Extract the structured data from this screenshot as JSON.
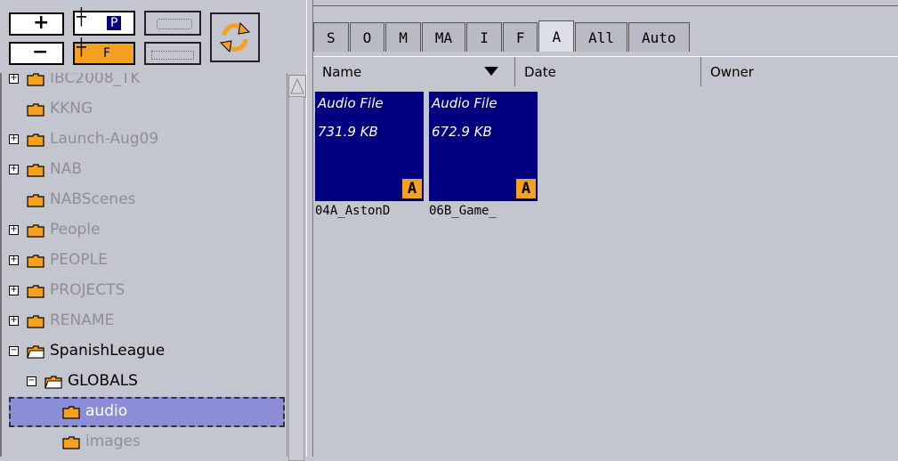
{
  "toolbar": {
    "buttons": [
      "+",
      "−",
      "P",
      "F"
    ]
  },
  "tree": {
    "items": [
      {
        "label": "IBC2008_TK",
        "expander": "+",
        "state": "dim"
      },
      {
        "label": "KKNG",
        "expander": "",
        "state": "dim"
      },
      {
        "label": "Launch-Aug09",
        "expander": "+",
        "state": "dim"
      },
      {
        "label": "NAB",
        "expander": "+",
        "state": "dim"
      },
      {
        "label": "NABScenes",
        "expander": "",
        "state": "dim"
      },
      {
        "label": "People",
        "expander": "+",
        "state": "dim"
      },
      {
        "label": "PEOPLE",
        "expander": "+",
        "state": "dim"
      },
      {
        "label": "PROJECTS",
        "expander": "+",
        "state": "dim"
      },
      {
        "label": "RENAME",
        "expander": "+",
        "state": "dim"
      },
      {
        "label": "SpanishLeague",
        "expander": "−",
        "state": "active"
      },
      {
        "label": "GLOBALS",
        "expander": "−",
        "state": "active"
      },
      {
        "label": "audio",
        "expander": "",
        "state": "selected"
      },
      {
        "label": "images",
        "expander": "",
        "state": "dim"
      }
    ]
  },
  "tabs": [
    {
      "label": "S"
    },
    {
      "label": "O"
    },
    {
      "label": "M"
    },
    {
      "label": "MA"
    },
    {
      "label": "I"
    },
    {
      "label": "F"
    },
    {
      "label": "A",
      "active": true
    },
    {
      "label": "All"
    },
    {
      "label": "Auto"
    }
  ],
  "columns": [
    {
      "label": "Name"
    },
    {
      "label": "Date"
    },
    {
      "label": "Owner"
    }
  ],
  "files": [
    {
      "type": "Audio File",
      "size": "731.9 KB",
      "badge": "A",
      "name": "04A_AstonD"
    },
    {
      "type": "Audio File",
      "size": "672.9 KB",
      "badge": "A",
      "name": "06B_Game_"
    }
  ],
  "colors": {
    "tile_bg": "#000080",
    "badge_bg": "#f4a020",
    "selection": "#8b8ed6"
  }
}
